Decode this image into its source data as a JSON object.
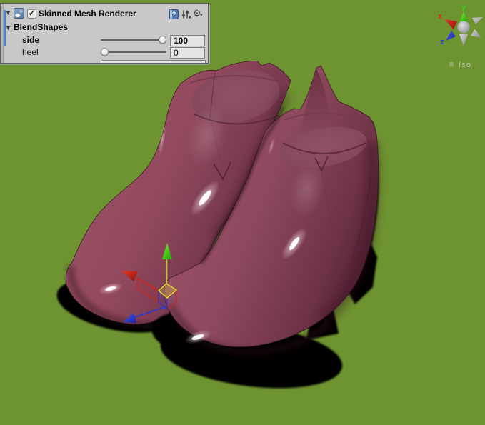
{
  "inspector": {
    "component": {
      "title": "Skinned Mesh Renderer",
      "enabled": true,
      "enabled_glyph": "✓",
      "foldout_glyph": "▼",
      "header_icons": {
        "help_glyph": "?",
        "settings_glyph": "⚙",
        "settings_caret": "▾"
      }
    },
    "blendshapes": {
      "label": "BlendShapes",
      "foldout_glyph": "▼",
      "rows": [
        {
          "name": "side",
          "value": "100",
          "overridden": true
        },
        {
          "name": "heel",
          "value": "0",
          "overridden": false
        }
      ]
    },
    "override_bar_color": "#4a82d8"
  },
  "viewport": {
    "background_color": "#6e9331",
    "scene_object": "pair of maroon ankle boots",
    "boot_color": "#9a4f66",
    "sole_color": "#060306",
    "orientation_gizmo": {
      "labels": {
        "x": "x",
        "y": "y",
        "z": "z"
      },
      "axis_colors": {
        "x": "#e02a1a",
        "y": "#35d51a",
        "z": "#2a46e8"
      }
    },
    "projection": {
      "menu_glyph": "≡",
      "label": "Iso"
    },
    "move_gizmo": {
      "axis_colors": {
        "x": "#cc2418",
        "y": "#b2d414",
        "z": "#2438dc"
      },
      "plane_highlight": "#e3e31e"
    }
  }
}
